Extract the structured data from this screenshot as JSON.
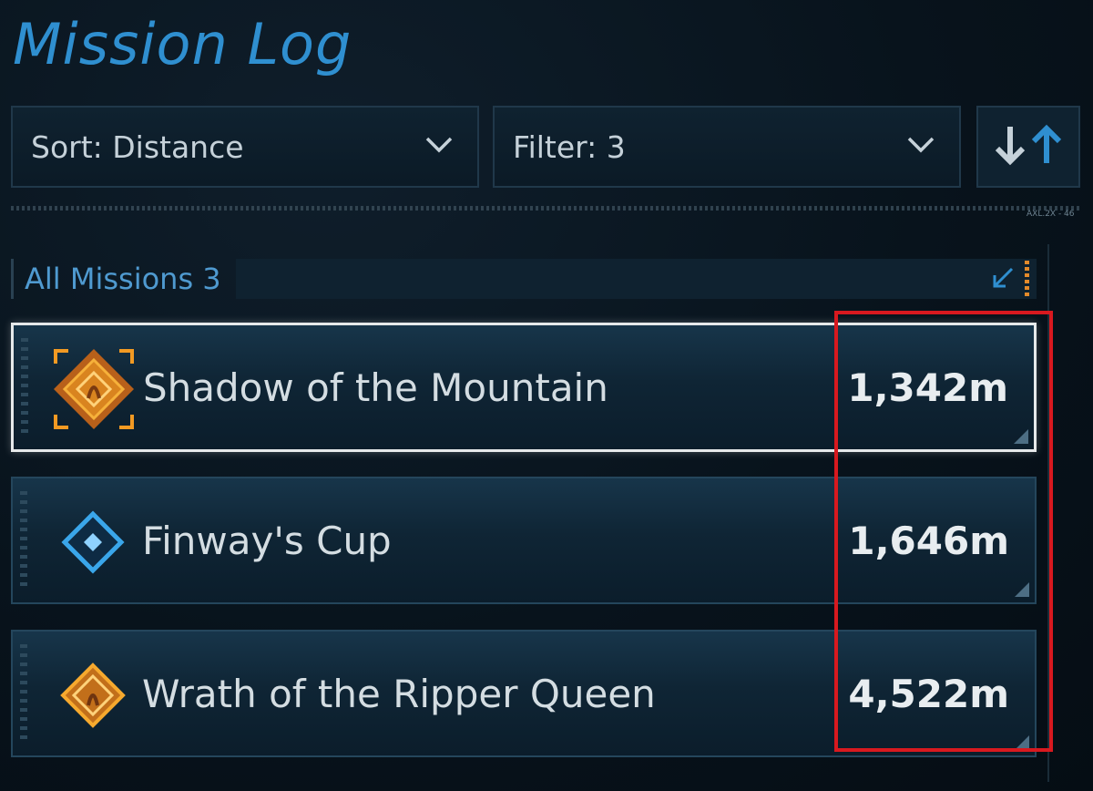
{
  "header": {
    "title": "Mission Log"
  },
  "controls": {
    "sort_label": "Sort: Distance",
    "filter_label": "Filter: 3",
    "sort_direction_icon": "sort-direction-icon"
  },
  "ruler": {
    "tag": "AXL.2X - 46"
  },
  "section": {
    "label": "All Missions 3"
  },
  "missions": [
    {
      "name": "Shadow of the Mountain",
      "distance": "1,342m",
      "icon": "legendary-mission-icon",
      "selected": true
    },
    {
      "name": "Finway's Cup",
      "distance": "1,646m",
      "icon": "side-mission-icon",
      "selected": false
    },
    {
      "name": "Wrath of the Ripper Queen",
      "distance": "4,522m",
      "icon": "legendary-mission-icon",
      "selected": false
    }
  ],
  "colors": {
    "accent": "#2f8fd0",
    "legendary": "#e8931f",
    "side": "#3aa6ea",
    "highlight": "#d8191f"
  }
}
